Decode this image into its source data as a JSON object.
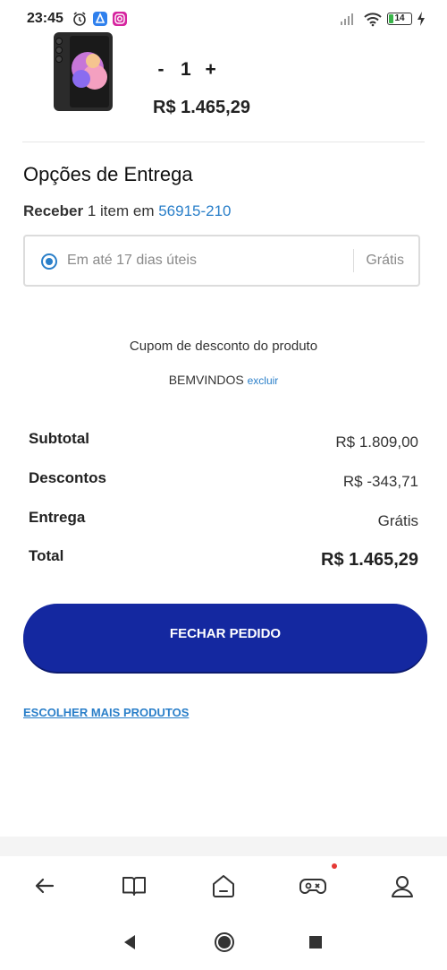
{
  "status_bar": {
    "time": "23:45",
    "battery": "14",
    "icons": [
      "alarm-icon",
      "browser-app-icon",
      "instagram-icon",
      "signal-icon",
      "wifi-icon",
      "battery-icon",
      "charging-icon"
    ]
  },
  "product": {
    "quantity_decrement": "-",
    "quantity": "1",
    "quantity_increment": "+",
    "price": "R$ 1.465,29"
  },
  "delivery": {
    "title": "Opções de Entrega",
    "receive_prefix": "Receber",
    "receive_middle": "1 item em",
    "zip": "56915-210",
    "option_label": "Em até 17 dias úteis",
    "option_price": "Grátis",
    "selected": true
  },
  "coupon": {
    "title": "Cupom de desconto do produto",
    "code": "BEMVINDOS",
    "remove_label": "excluir"
  },
  "summary": {
    "subtotal_label": "Subtotal",
    "subtotal_value": "R$ 1.809,00",
    "discount_label": "Descontos",
    "discount_value": "R$ -343,71",
    "shipping_label": "Entrega",
    "shipping_value": "Grátis",
    "total_label": "Total",
    "total_value": "R$ 1.465,29"
  },
  "actions": {
    "checkout": "FECHAR PEDIDO",
    "continue_shopping": "ESCOLHER MAIS PRODUTOS"
  },
  "bottom_nav": [
    "back-arrow-icon",
    "book-icon",
    "home-icon",
    "gamepad-icon",
    "profile-icon"
  ],
  "colors": {
    "primary": "#1428a0",
    "link": "#2a7fc9",
    "notification": "#e53935"
  }
}
